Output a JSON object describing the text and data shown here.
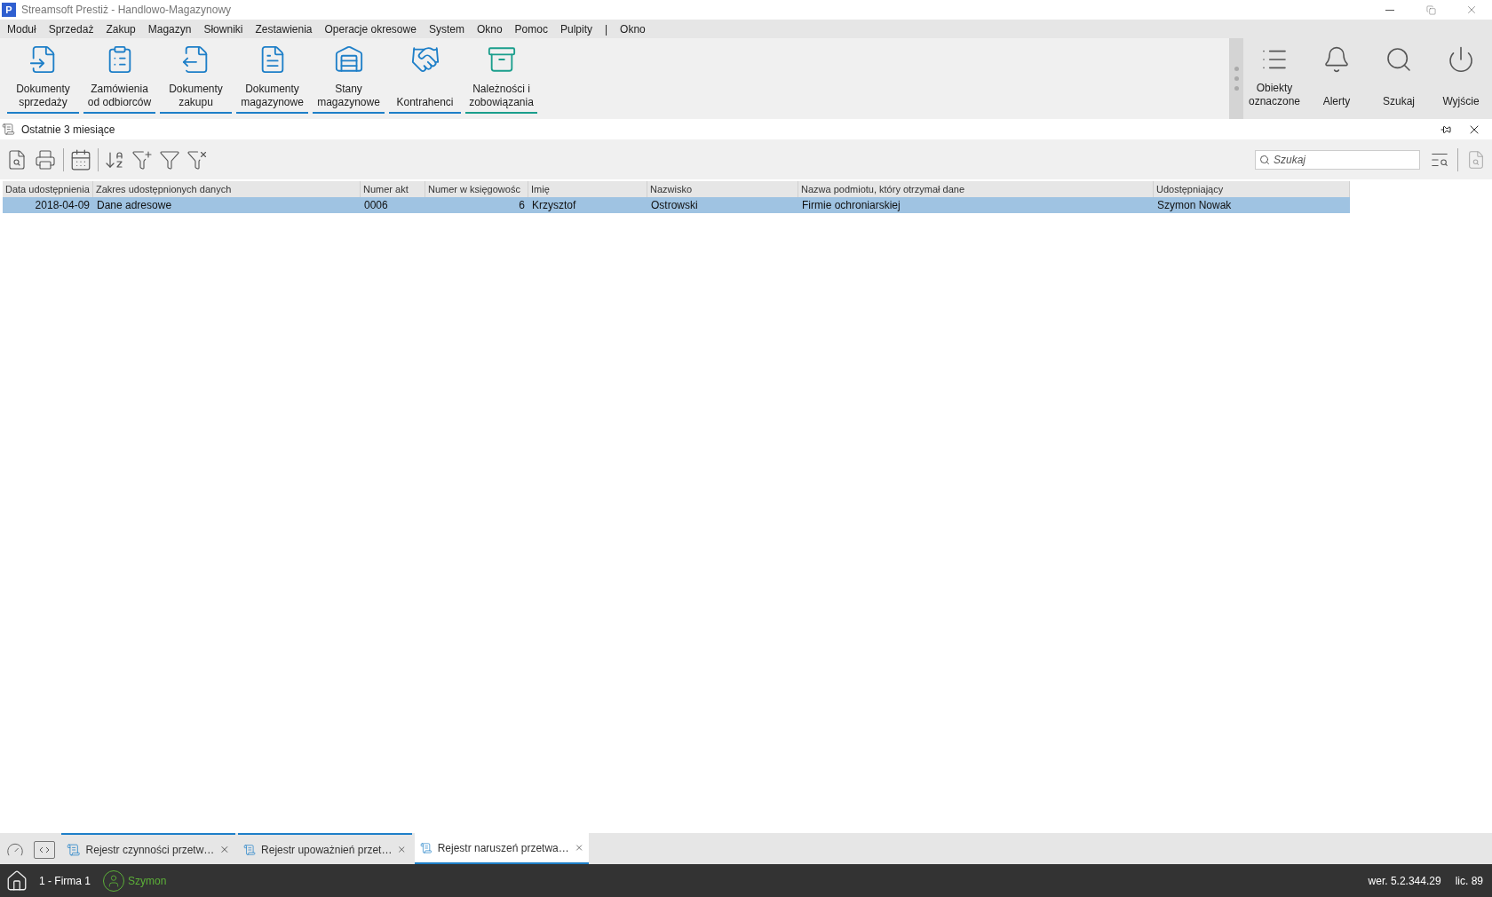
{
  "window": {
    "title": "Streamsoft Prestiż - Handlowo-Magazynowy",
    "logo": "P"
  },
  "menu": [
    "Moduł",
    "Sprzedaż",
    "Zakup",
    "Magazyn",
    "Słowniki",
    "Zestawienia",
    "Operacje okresowe",
    "System",
    "Okno",
    "Pomoc",
    "Pulpity"
  ],
  "menu_separator": "|",
  "menu_extra": [
    "Okno"
  ],
  "ribbon": [
    {
      "label": "Dokumenty sprzedaży",
      "color": "#1e7fc8"
    },
    {
      "label": "Zamówienia od odbiorców",
      "color": "#1e7fc8"
    },
    {
      "label": "Dokumenty zakupu",
      "color": "#1e7fc8"
    },
    {
      "label": "Dokumenty magazynowe",
      "color": "#1e7fc8"
    },
    {
      "label": "Stany magazynowe",
      "color": "#1e7fc8"
    },
    {
      "label": "Kontrahenci",
      "color": "#1e7fc8"
    },
    {
      "label": "Należności i zobowiązania",
      "color": "#1a9e8c"
    }
  ],
  "ribbon_right": [
    "Obiekty oznaczone",
    "Alerty",
    "Szukaj",
    "Wyjście"
  ],
  "panel": {
    "title": "Ostatnie 3 miesiące"
  },
  "search": {
    "placeholder": "Szukaj"
  },
  "table": {
    "columns": [
      "Data udostępnienia",
      "Zakres udostępnionych danych",
      "Numer akt",
      "Numer w księgowośc",
      "Imię",
      "Nazwisko",
      "Nazwa podmiotu, który otrzymał dane",
      "Udostępniający"
    ],
    "rows": [
      {
        "selected": true,
        "cells": [
          "2018-04-09",
          "Dane adresowe",
          "0006",
          "6",
          "Krzysztof",
          "Ostrowski",
          "Firmie ochroniarskiej",
          "Szymon Nowak"
        ]
      }
    ]
  },
  "tabs": [
    {
      "label": "Rejestr czynności przetw…",
      "selected": false
    },
    {
      "label": "Rejestr upoważnień przet…",
      "selected": false
    },
    {
      "label": "Rejestr naruszeń przetwa…",
      "selected": true
    }
  ],
  "status_bar": {
    "company": "1 - Firma 1",
    "user": "Szymon",
    "version": "wer. 5.2.344.29",
    "license": "lic. 89"
  }
}
